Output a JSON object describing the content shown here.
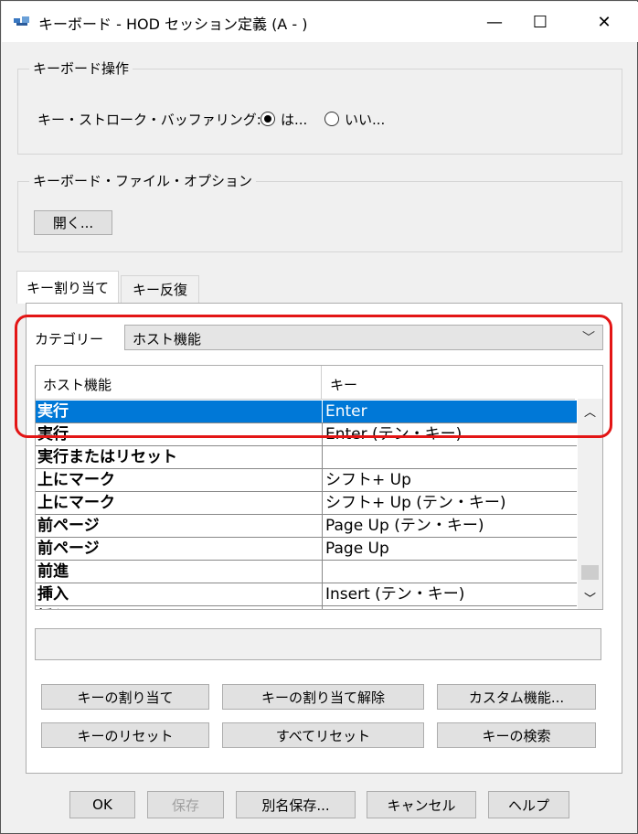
{
  "window": {
    "title": "キーボード - HOD セッション定義 (A - )",
    "minimize": "—",
    "maximize": "☐",
    "close": "✕"
  },
  "keyboard_ops": {
    "legend": "キーボード操作",
    "buffering_label": "キー・ストローク・バッファリング:",
    "yes_label": "は...",
    "no_label": "いい...",
    "selected": "yes"
  },
  "file_options": {
    "legend": "キーボード・ファイル・オプション",
    "open_button": "開く..."
  },
  "tabs": [
    {
      "label": "キー割り当て",
      "active": true
    },
    {
      "label": "キー反復",
      "active": false
    }
  ],
  "category": {
    "label": "カテゴリー",
    "value": "ホスト機能"
  },
  "table": {
    "headers": [
      "ホスト機能",
      "キー"
    ],
    "rows": [
      {
        "function": "実行",
        "key": "Enter",
        "selected": true
      },
      {
        "function": "実行",
        "key": "Enter (テン・キー)",
        "selected": false
      },
      {
        "function": "実行またはリセット",
        "key": "",
        "selected": false
      },
      {
        "function": "上にマーク",
        "key": "シフト+ Up",
        "selected": false
      },
      {
        "function": "上にマーク",
        "key": "シフト+ Up (テン・キー)",
        "selected": false
      },
      {
        "function": "前ページ",
        "key": "Page Up (テン・キー)",
        "selected": false
      },
      {
        "function": "前ページ",
        "key": "Page Up",
        "selected": false
      },
      {
        "function": "前進",
        "key": "",
        "selected": false
      },
      {
        "function": "挿入",
        "key": "Insert (テン・キー)",
        "selected": false
      },
      {
        "function": "挿入",
        "key": "Insert",
        "selected": false
      }
    ]
  },
  "action_buttons": {
    "assign": "キーの割り当て",
    "unassign": "キーの割り当て解除",
    "custom": "カスタム機能...",
    "reset_key": "キーのリセット",
    "reset_all": "すべてリセット",
    "search": "キーの検索"
  },
  "footer_buttons": {
    "ok": "OK",
    "save": "保存",
    "save_as": "別名保存...",
    "cancel": "キャンセル",
    "help": "ヘルプ"
  },
  "colors": {
    "selection": "#0078d7",
    "highlight_border": "#e31515"
  }
}
